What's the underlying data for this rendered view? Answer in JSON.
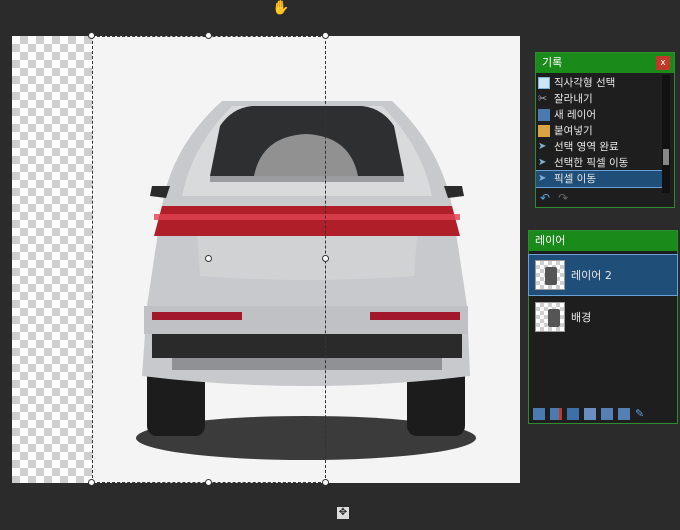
{
  "history": {
    "title": "기록",
    "close_label": "x",
    "items": [
      {
        "label": "직사각형 선택",
        "icon": "rect-select-icon"
      },
      {
        "label": "잘라내기",
        "icon": "scissors-icon"
      },
      {
        "label": "새 레이어",
        "icon": "new-layer-icon"
      },
      {
        "label": "붙여넣기",
        "icon": "paste-icon"
      },
      {
        "label": "선택 영역 완료",
        "icon": "move-selection-icon"
      },
      {
        "label": "선택한 픽셀 이동",
        "icon": "move-pixels-icon"
      },
      {
        "label": "픽셀 이동",
        "icon": "move-pixels-icon"
      }
    ],
    "selected_index": 6,
    "undo_icon": "undo-icon",
    "redo_icon": "redo-icon"
  },
  "layers": {
    "title": "레이어",
    "items": [
      {
        "label": "레이어 2",
        "selected": true
      },
      {
        "label": "배경",
        "selected": false
      }
    ],
    "tools": [
      "add-layer-icon",
      "delete-layer-icon",
      "duplicate-layer-icon",
      "merge-down-icon",
      "move-up-icon",
      "move-down-icon",
      "properties-icon"
    ]
  },
  "colors": {
    "panel_header": "#1a8a1a",
    "selection_blue": "#1f4e79"
  }
}
